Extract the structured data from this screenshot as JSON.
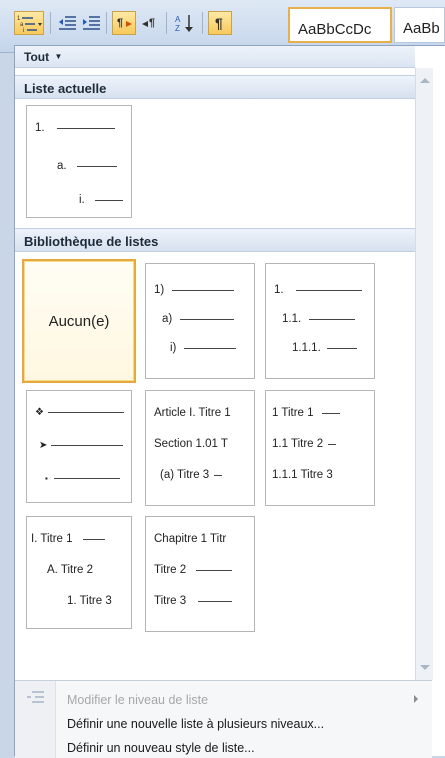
{
  "ribbon": {
    "toolbar_icons": [
      "multilevel-list-icon",
      "decrease-indent-icon",
      "increase-indent-icon",
      "ltr-icon",
      "rtl-icon",
      "sort-icon",
      "pilcrow-icon"
    ],
    "style_gallery": [
      "AaBbCcDc",
      "AaBb"
    ]
  },
  "filter": {
    "label": "Tout",
    "arrow": "▼"
  },
  "sections": {
    "current": "Liste actuelle",
    "library": "Bibliothèque de listes"
  },
  "current_list": {
    "lines": [
      "1.",
      "a.",
      "i."
    ]
  },
  "library": {
    "none_label": "Aucun(e)",
    "numbered_1": [
      "1)",
      "a)",
      "i)"
    ],
    "numbered_2": [
      "1.",
      "1.1.",
      "1.1.1."
    ],
    "bullets": [
      "❖",
      "➤",
      "▪"
    ],
    "article": [
      "Article I. Titre 1",
      "Section 1.01 T",
      "(a) Titre 3"
    ],
    "titre_numbered": [
      "1 Titre 1",
      "1.1 Titre 2",
      "1.1.1 Titre 3"
    ],
    "roman": [
      "I. Titre 1",
      "A. Titre 2",
      "1. Titre 3"
    ],
    "chapitre": [
      "Chapitre 1 Titr",
      "Titre 2",
      "Titre 3"
    ]
  },
  "menu": {
    "change_level": "Modifier le niveau de liste",
    "define_multilevel": "Définir une nouvelle liste à plusieurs niveaux...",
    "define_style": "Définir un nouveau style de liste..."
  },
  "colors": {
    "hover_border": "#e5a940",
    "header_bg": "#d6e1ef",
    "disabled_text": "#a7a7a7"
  }
}
